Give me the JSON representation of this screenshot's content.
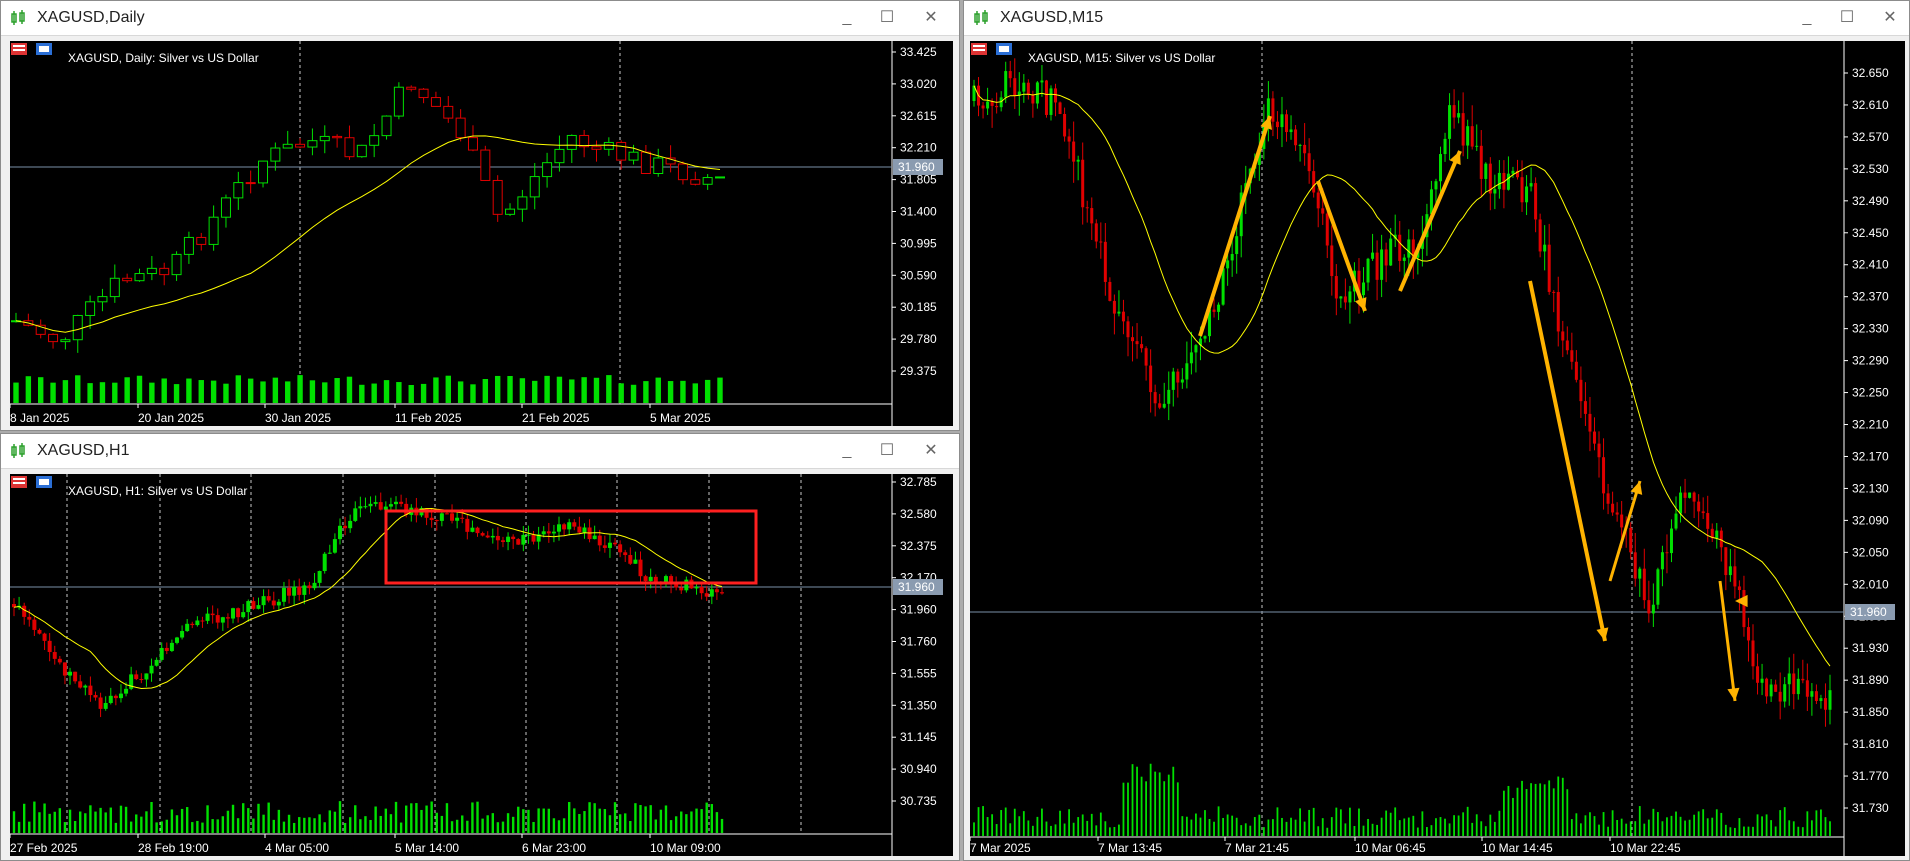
{
  "colors": {
    "bull": "#00e000",
    "bear": "#e00000",
    "ma": "#ffff00",
    "axis": "#ffffff",
    "grid": "#c8c8c8",
    "arrow": "#ffb300",
    "box": "#ff2020",
    "priceLine": "#7a8fa8"
  },
  "windows": {
    "daily": {
      "title": "XAGUSD,Daily",
      "label": "XAGUSD, Daily:  Silver vs US Dollar",
      "yTicks": [
        "33.425",
        "33.020",
        "32.615",
        "32.210",
        "31.805",
        "31.400",
        "30.995",
        "30.590",
        "30.185",
        "29.780",
        "29.375"
      ],
      "xTicks": [
        "8 Jan 2025",
        "20 Jan 2025",
        "30 Jan 2025",
        "11 Feb 2025",
        "21 Feb 2025",
        "5 Mar 2025"
      ],
      "priceTag": "31.960",
      "buttons": {
        "minimize": "_",
        "maximize": "☐",
        "close": "✕"
      }
    },
    "h1": {
      "title": "XAGUSD,H1",
      "label": "XAGUSD, H1:  Silver vs US Dollar",
      "yTicks": [
        "32.785",
        "32.580",
        "32.375",
        "32.170",
        "31.960",
        "31.760",
        "31.555",
        "31.350",
        "31.145",
        "30.940",
        "30.735"
      ],
      "xTicks": [
        "27 Feb 2025",
        "28 Feb 19:00",
        "4 Mar 05:00",
        "5 Mar 14:00",
        "6 Mar 23:00",
        "10 Mar 09:00"
      ],
      "priceTag": "31.960",
      "buttons": {
        "minimize": "_",
        "maximize": "☐",
        "close": "✕"
      }
    },
    "m15": {
      "title": "XAGUSD,M15",
      "label": "XAGUSD, M15:  Silver vs US Dollar",
      "yTicks": [
        "32.650",
        "32.610",
        "32.570",
        "32.530",
        "32.490",
        "32.450",
        "32.410",
        "32.370",
        "32.330",
        "32.290",
        "32.250",
        "32.210",
        "32.170",
        "32.130",
        "32.090",
        "32.050",
        "32.010",
        "31.960",
        "31.930",
        "31.890",
        "31.850",
        "31.810",
        "31.770",
        "31.730"
      ],
      "xTicks": [
        "7 Mar 2025",
        "7 Mar 13:45",
        "7 Mar 21:45",
        "10 Mar 06:45",
        "10 Mar 14:45",
        "10 Mar 22:45"
      ],
      "priceTag": "31.960",
      "buttons": {
        "minimize": "_",
        "maximize": "☐",
        "close": "✕"
      }
    }
  }
}
